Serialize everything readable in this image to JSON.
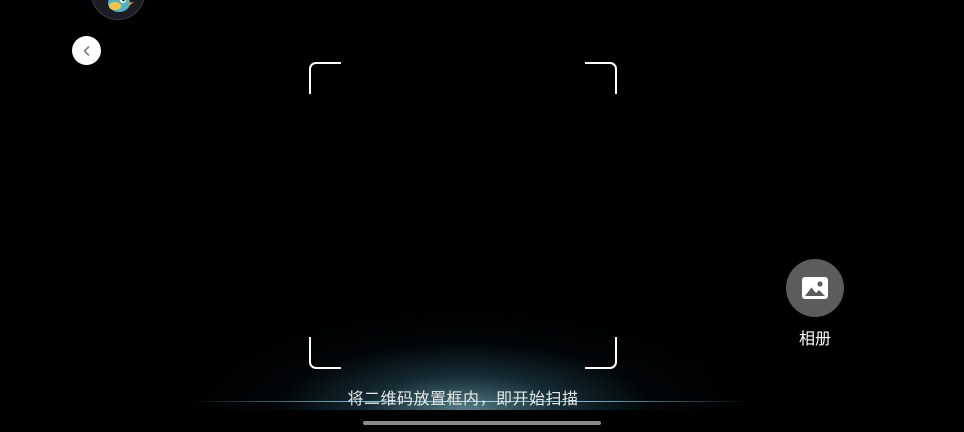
{
  "scanner": {
    "hint_text": "将二维码放置框内，即开始扫描",
    "album_label": "相册"
  },
  "icons": {
    "avatar": "bird-avatar-icon",
    "back": "chevron-left-icon",
    "album": "image-icon"
  },
  "colors": {
    "background": "#000000",
    "frame_corners": "#ffffff",
    "album_button": "#5c5c5c",
    "glow": "#96e1f5"
  }
}
